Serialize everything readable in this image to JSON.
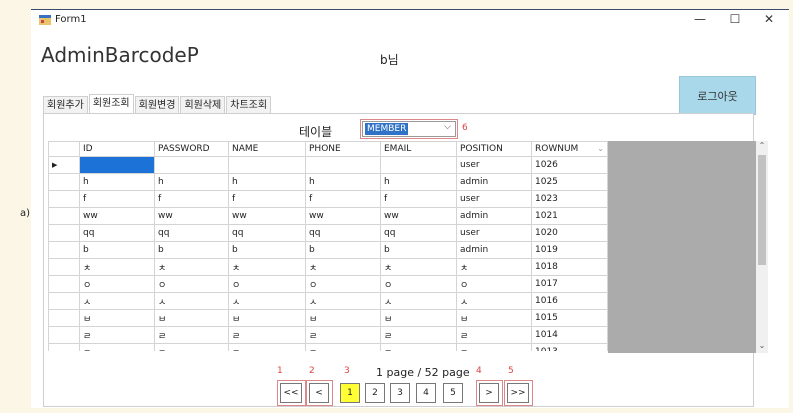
{
  "window": {
    "title": "Form1",
    "minimize": "—",
    "maximize": "☐",
    "close": "✕"
  },
  "app": {
    "title": "AdminBarcodeP",
    "user_label": "b님",
    "logout_label": "로그아웃"
  },
  "tabs": [
    {
      "label": "회원추가"
    },
    {
      "label": "회원조회"
    },
    {
      "label": "회원변경"
    },
    {
      "label": "회원삭제"
    },
    {
      "label": "차트조회"
    }
  ],
  "table_selector": {
    "label": "테이블",
    "value": "MEMBER",
    "marker": "6"
  },
  "grid": {
    "columns": [
      "ID",
      "PASSWORD",
      "NAME",
      "PHONE",
      "EMAIL",
      "POSITION",
      "ROWNUM"
    ],
    "rows": [
      [
        "",
        "",
        "",
        "",
        "",
        "user",
        "1026"
      ],
      [
        "h",
        "h",
        "h",
        "h",
        "h",
        "admin",
        "1025"
      ],
      [
        "f",
        "f",
        "f",
        "f",
        "f",
        "user",
        "1023"
      ],
      [
        "ww",
        "ww",
        "ww",
        "ww",
        "ww",
        "admin",
        "1021"
      ],
      [
        "qq",
        "qq",
        "qq",
        "qq",
        "qq",
        "user",
        "1020"
      ],
      [
        "b",
        "b",
        "b",
        "b",
        "b",
        "admin",
        "1019"
      ],
      [
        "ㅊ",
        "ㅊ",
        "ㅊ",
        "ㅊ",
        "ㅊ",
        "ㅊ",
        "1018"
      ],
      [
        "ㅇ",
        "ㅇ",
        "ㅇ",
        "ㅇ",
        "ㅇ",
        "ㅇ",
        "1017"
      ],
      [
        "ㅅ",
        "ㅅ",
        "ㅅ",
        "ㅅ",
        "ㅅ",
        "ㅅ",
        "1016"
      ],
      [
        "ㅂ",
        "ㅂ",
        "ㅂ",
        "ㅂ",
        "ㅂ",
        "ㅂ",
        "1015"
      ],
      [
        "ㄹ",
        "ㄹ",
        "ㄹ",
        "ㄹ",
        "ㄹ",
        "ㄹ",
        "1014"
      ],
      [
        "ㄷ",
        "ㄷ",
        "ㄷ",
        "ㄷ",
        "ㄷ",
        "ㄷ",
        "1013"
      ]
    ]
  },
  "pagination": {
    "info": "1 page / 52 page",
    "first": "<<",
    "prev": "<",
    "pages": [
      "1",
      "2",
      "3",
      "4",
      "5"
    ],
    "current_page": "1",
    "next": ">",
    "last": ">>",
    "markers": [
      "1",
      "2",
      "3",
      "4",
      "5"
    ]
  },
  "annotation": {
    "side_label": "a)"
  },
  "colors": {
    "logout_bg": "#a8d8ea",
    "current_page_bg": "#ffff33",
    "selection": "#1c72d6",
    "marker_red": "#dd4444"
  }
}
